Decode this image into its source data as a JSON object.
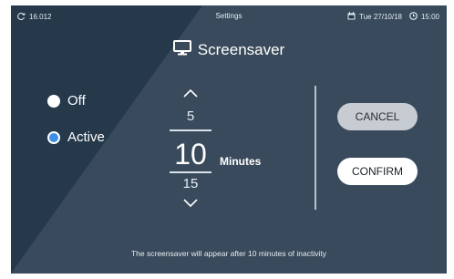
{
  "colors": {
    "background": "#25394b",
    "accent": "#3f8fe8",
    "cancel_button": "#c6ccd2",
    "confirm_button": "#ffffff"
  },
  "status_bar": {
    "version": "16.012",
    "title": "Settings",
    "date": "Tue 27/10/18",
    "time": "15:00",
    "icons": [
      "refresh-icon",
      "calendar-icon",
      "clock-icon"
    ]
  },
  "page": {
    "title": "Screensaver",
    "title_icon": "monitor-icon"
  },
  "options": [
    {
      "label": "Off",
      "selected": false
    },
    {
      "label": "Active",
      "selected": true
    }
  ],
  "picker": {
    "previous": "5",
    "current": "10",
    "next": "15",
    "unit": "Minutes"
  },
  "buttons": {
    "cancel": "CANCEL",
    "confirm": "CONFIRM"
  },
  "footer": "The screensaver will appear after 10 minutes of inactivity"
}
